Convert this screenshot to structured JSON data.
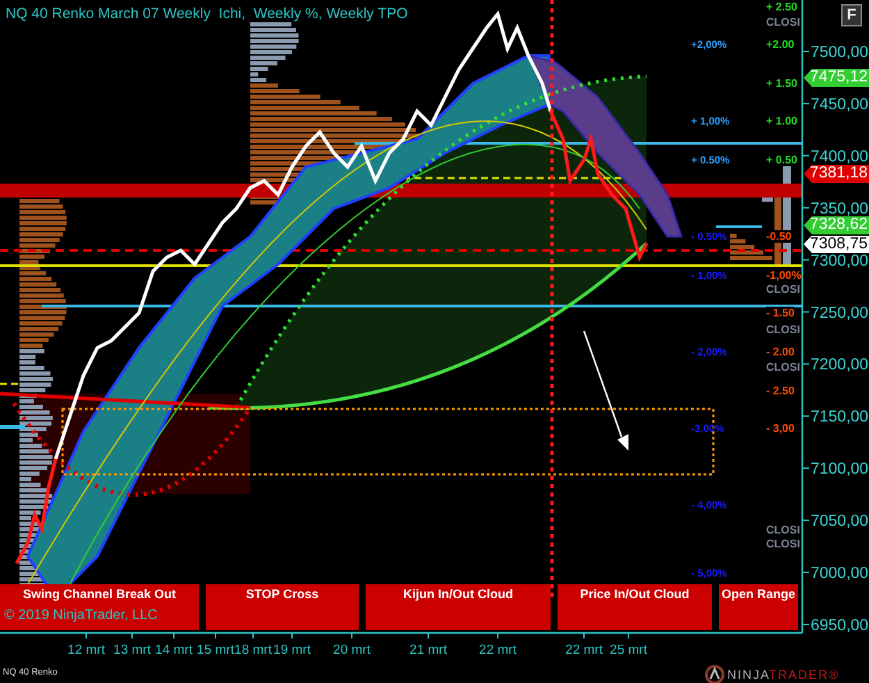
{
  "title": "NQ 40 Renko March 07 Weekly  Ichi,  Weekly %, Weekly TPO",
  "f_button": "F",
  "percent_levels": [
    {
      "text": "+2,00%",
      "color": "#2ea0ff"
    },
    {
      "text": "+ 1,00%",
      "color": "#2ea0ff"
    },
    {
      "text": "+ 0.50%",
      "color": "#2ea0ff"
    },
    {
      "text": "- 0.50%",
      "color": "#1a1aff"
    },
    {
      "text": "- 1,00%",
      "color": "#1a1aff"
    },
    {
      "text": "- 2,00%",
      "color": "#1a1aff"
    },
    {
      "text": "-3,00%",
      "color": "#1a1aff"
    },
    {
      "text": "- 4,00%",
      "color": "#1a1aff"
    },
    {
      "text": "- 5,00%",
      "color": "#1a1aff"
    }
  ],
  "closing_levels": [
    {
      "text": "+ 2.50",
      "color": "#22dd22"
    },
    {
      "text": "CLOSI",
      "color": "#7a8290"
    },
    {
      "text": "+2.00",
      "color": "#22dd22"
    },
    {
      "text": "+ 1.50",
      "color": "#22dd22"
    },
    {
      "text": "+ 1.00",
      "color": "#22dd22"
    },
    {
      "text": "+ 0.50",
      "color": "#22dd22"
    },
    {
      "text": "-0.50",
      "color": "#ff4a00"
    },
    {
      "text": "-1,00%",
      "color": "#ff4a00"
    },
    {
      "text": "CLOSI",
      "color": "#7a8290"
    },
    {
      "text": "- 1.50",
      "color": "#ff4a00"
    },
    {
      "text": "CLOSI",
      "color": "#7a8290"
    },
    {
      "text": "- 2.00",
      "color": "#ff4a00"
    },
    {
      "text": "CLOSI",
      "color": "#7a8290"
    },
    {
      "text": "- 2.50",
      "color": "#ff4a00"
    },
    {
      "text": "- 3,00",
      "color": "#ff4a00"
    },
    {
      "text": "CLOSI",
      "color": "#7a8290"
    },
    {
      "text": "CLOSI",
      "color": "#7a8290"
    }
  ],
  "price_axis": [
    "7500,00",
    "7450,00",
    "7400,00",
    "7350,00",
    "7300,00",
    "7250,00",
    "7200,00",
    "7150,00",
    "7100,00",
    "7050,00",
    "7000,00",
    "6950,00"
  ],
  "price_flags": [
    {
      "text": "7475,12",
      "color": "#33cc33"
    },
    {
      "text": "7381,18",
      "color": "#e00000"
    },
    {
      "text": "7328,62",
      "color": "#33cc33"
    },
    {
      "text": "7308,75",
      "color": "#ffffff"
    }
  ],
  "signals": [
    "Swing Channel Break Out",
    "STOP Cross",
    "Kijun In/Out Cloud",
    "Price In/Out Cloud",
    "Open Range"
  ],
  "copyright": "© 2019 NinjaTrader, LLC",
  "date_axis": [
    "12 mrt",
    "13 mrt",
    "14 mrt",
    "15 mrt",
    "18 mrt",
    "19 mrt",
    "20 mrt",
    "21 mrt",
    "22 mrt",
    "22 mrt",
    "25 mrt"
  ],
  "instrument": "NQ 40 Renko",
  "logo": {
    "first": "NINJA",
    "second": "TRADER®"
  }
}
